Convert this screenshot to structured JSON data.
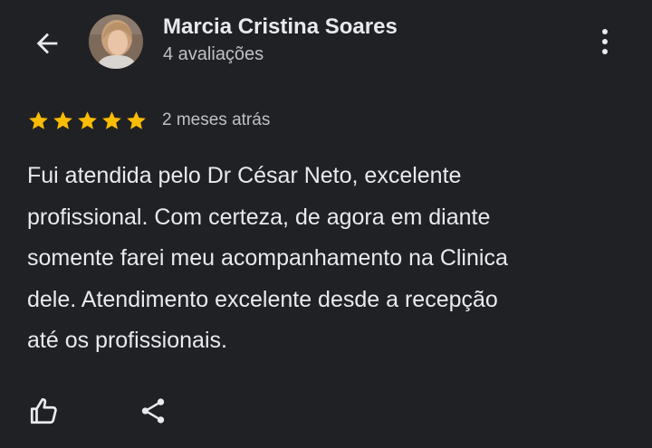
{
  "header": {
    "back_icon": "arrow-back-icon",
    "reviewer_name": "Marcia Cristina Soares",
    "review_count": "4 avaliações",
    "more_icon": "more-vert-icon"
  },
  "review": {
    "rating": 5,
    "rating_max": 5,
    "star_color": "#fbbc04",
    "date": "2 meses atrás",
    "text_lines": [
      "Fui atendida pelo Dr César Neto, excelente",
      "profissional. Com certeza, de agora em diante",
      "somente farei meu acompanhamento na Clinica",
      "dele. Atendimento excelente desde a recepção",
      "até os profissionais."
    ]
  },
  "actions": {
    "like_icon": "thumb-up-icon",
    "share_icon": "share-icon"
  },
  "colors": {
    "background": "#202124",
    "primary_text": "#e8eaed",
    "secondary_text": "#bdc1c6"
  }
}
